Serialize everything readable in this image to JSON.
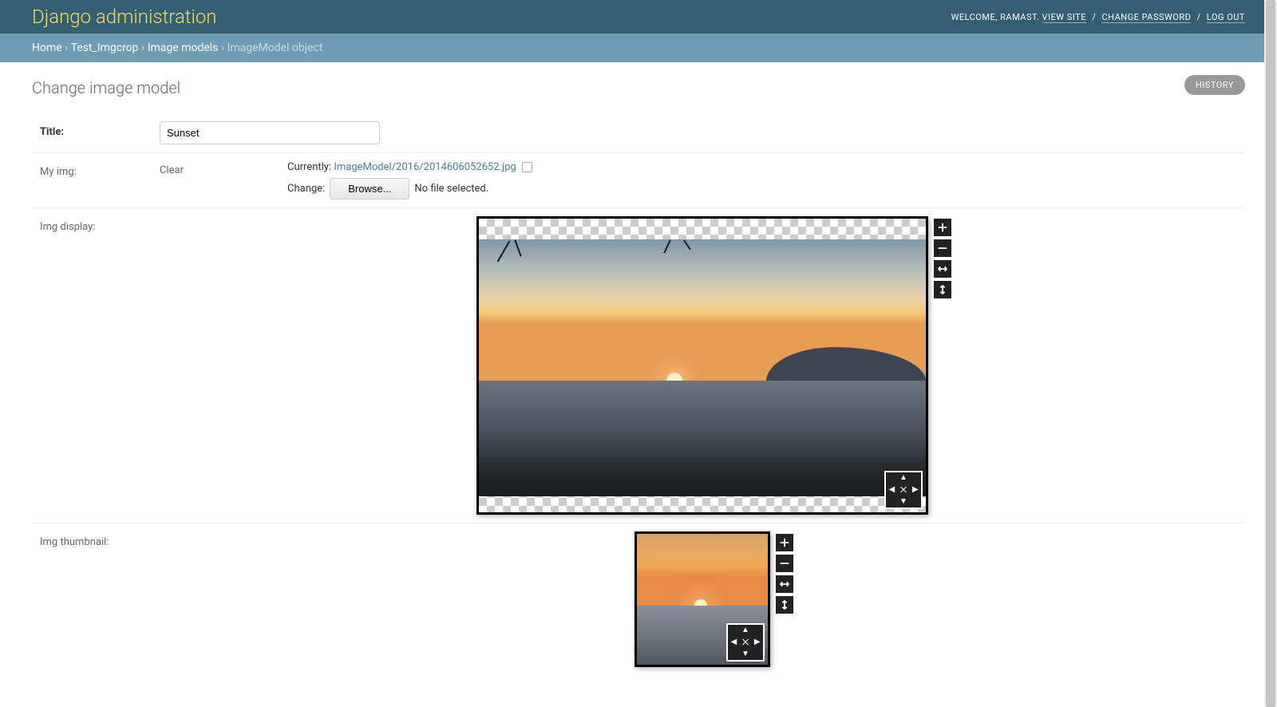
{
  "branding": {
    "title": "Django administration"
  },
  "usertools": {
    "welcome_prefix": "WELCOME, ",
    "username": "RAMAST",
    "view_site": "VIEW SITE",
    "change_password": "CHANGE PASSWORD",
    "logout": "LOG OUT"
  },
  "breadcrumbs": {
    "home": "Home",
    "app": "Test_Imgcrop",
    "model": "Image models",
    "current": "ImageModel object"
  },
  "page": {
    "title": "Change image model",
    "history_btn": "HISTORY"
  },
  "form": {
    "title_label": "Title:",
    "title_value": "Sunset",
    "myimg_label": "My img:",
    "clear_label": "Clear",
    "currently_label": "Currently:",
    "currently_file": "ImageModel/2016/2014606052652.jpg",
    "change_label": "Change:",
    "browse_label": "Browse...",
    "no_file": "No file selected.",
    "display_label": "Img display:",
    "thumb_label": "Img thumbnail:"
  },
  "controls": {
    "zoom_in": "plus-icon",
    "zoom_out": "minus-icon",
    "fit_h": "fit-horizontal-icon",
    "fit_v": "fit-vertical-icon",
    "move": "move-icon"
  },
  "colors": {
    "header_bg": "#365e73",
    "brand_text": "#f5dd5d",
    "crumbs_bg": "#6f9cb3",
    "link": "#447e9b"
  }
}
